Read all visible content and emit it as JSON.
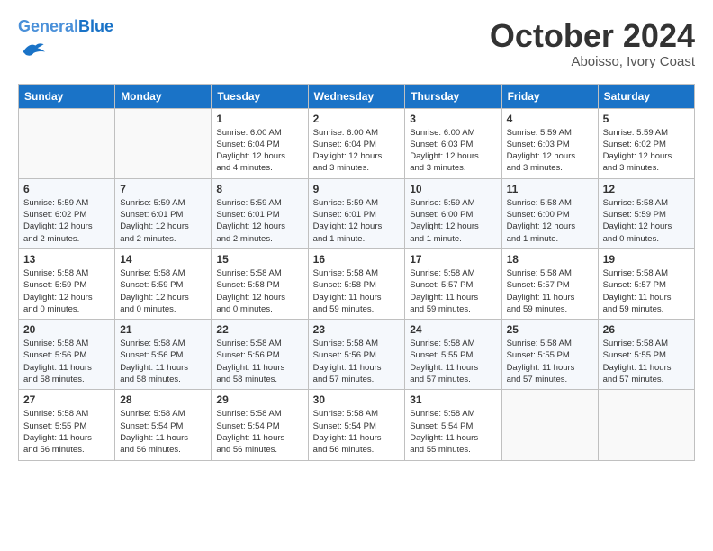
{
  "logo": {
    "text_general": "General",
    "text_blue": "Blue"
  },
  "header": {
    "month": "October 2024",
    "location": "Aboisso, Ivory Coast"
  },
  "weekdays": [
    "Sunday",
    "Monday",
    "Tuesday",
    "Wednesday",
    "Thursday",
    "Friday",
    "Saturday"
  ],
  "weeks": [
    [
      {
        "day": "",
        "info": ""
      },
      {
        "day": "",
        "info": ""
      },
      {
        "day": "1",
        "info": "Sunrise: 6:00 AM\nSunset: 6:04 PM\nDaylight: 12 hours\nand 4 minutes."
      },
      {
        "day": "2",
        "info": "Sunrise: 6:00 AM\nSunset: 6:04 PM\nDaylight: 12 hours\nand 3 minutes."
      },
      {
        "day": "3",
        "info": "Sunrise: 6:00 AM\nSunset: 6:03 PM\nDaylight: 12 hours\nand 3 minutes."
      },
      {
        "day": "4",
        "info": "Sunrise: 5:59 AM\nSunset: 6:03 PM\nDaylight: 12 hours\nand 3 minutes."
      },
      {
        "day": "5",
        "info": "Sunrise: 5:59 AM\nSunset: 6:02 PM\nDaylight: 12 hours\nand 3 minutes."
      }
    ],
    [
      {
        "day": "6",
        "info": "Sunrise: 5:59 AM\nSunset: 6:02 PM\nDaylight: 12 hours\nand 2 minutes."
      },
      {
        "day": "7",
        "info": "Sunrise: 5:59 AM\nSunset: 6:01 PM\nDaylight: 12 hours\nand 2 minutes."
      },
      {
        "day": "8",
        "info": "Sunrise: 5:59 AM\nSunset: 6:01 PM\nDaylight: 12 hours\nand 2 minutes."
      },
      {
        "day": "9",
        "info": "Sunrise: 5:59 AM\nSunset: 6:01 PM\nDaylight: 12 hours\nand 1 minute."
      },
      {
        "day": "10",
        "info": "Sunrise: 5:59 AM\nSunset: 6:00 PM\nDaylight: 12 hours\nand 1 minute."
      },
      {
        "day": "11",
        "info": "Sunrise: 5:58 AM\nSunset: 6:00 PM\nDaylight: 12 hours\nand 1 minute."
      },
      {
        "day": "12",
        "info": "Sunrise: 5:58 AM\nSunset: 5:59 PM\nDaylight: 12 hours\nand 0 minutes."
      }
    ],
    [
      {
        "day": "13",
        "info": "Sunrise: 5:58 AM\nSunset: 5:59 PM\nDaylight: 12 hours\nand 0 minutes."
      },
      {
        "day": "14",
        "info": "Sunrise: 5:58 AM\nSunset: 5:59 PM\nDaylight: 12 hours\nand 0 minutes."
      },
      {
        "day": "15",
        "info": "Sunrise: 5:58 AM\nSunset: 5:58 PM\nDaylight: 12 hours\nand 0 minutes."
      },
      {
        "day": "16",
        "info": "Sunrise: 5:58 AM\nSunset: 5:58 PM\nDaylight: 11 hours\nand 59 minutes."
      },
      {
        "day": "17",
        "info": "Sunrise: 5:58 AM\nSunset: 5:57 PM\nDaylight: 11 hours\nand 59 minutes."
      },
      {
        "day": "18",
        "info": "Sunrise: 5:58 AM\nSunset: 5:57 PM\nDaylight: 11 hours\nand 59 minutes."
      },
      {
        "day": "19",
        "info": "Sunrise: 5:58 AM\nSunset: 5:57 PM\nDaylight: 11 hours\nand 59 minutes."
      }
    ],
    [
      {
        "day": "20",
        "info": "Sunrise: 5:58 AM\nSunset: 5:56 PM\nDaylight: 11 hours\nand 58 minutes."
      },
      {
        "day": "21",
        "info": "Sunrise: 5:58 AM\nSunset: 5:56 PM\nDaylight: 11 hours\nand 58 minutes."
      },
      {
        "day": "22",
        "info": "Sunrise: 5:58 AM\nSunset: 5:56 PM\nDaylight: 11 hours\nand 58 minutes."
      },
      {
        "day": "23",
        "info": "Sunrise: 5:58 AM\nSunset: 5:56 PM\nDaylight: 11 hours\nand 57 minutes."
      },
      {
        "day": "24",
        "info": "Sunrise: 5:58 AM\nSunset: 5:55 PM\nDaylight: 11 hours\nand 57 minutes."
      },
      {
        "day": "25",
        "info": "Sunrise: 5:58 AM\nSunset: 5:55 PM\nDaylight: 11 hours\nand 57 minutes."
      },
      {
        "day": "26",
        "info": "Sunrise: 5:58 AM\nSunset: 5:55 PM\nDaylight: 11 hours\nand 57 minutes."
      }
    ],
    [
      {
        "day": "27",
        "info": "Sunrise: 5:58 AM\nSunset: 5:55 PM\nDaylight: 11 hours\nand 56 minutes."
      },
      {
        "day": "28",
        "info": "Sunrise: 5:58 AM\nSunset: 5:54 PM\nDaylight: 11 hours\nand 56 minutes."
      },
      {
        "day": "29",
        "info": "Sunrise: 5:58 AM\nSunset: 5:54 PM\nDaylight: 11 hours\nand 56 minutes."
      },
      {
        "day": "30",
        "info": "Sunrise: 5:58 AM\nSunset: 5:54 PM\nDaylight: 11 hours\nand 56 minutes."
      },
      {
        "day": "31",
        "info": "Sunrise: 5:58 AM\nSunset: 5:54 PM\nDaylight: 11 hours\nand 55 minutes."
      },
      {
        "day": "",
        "info": ""
      },
      {
        "day": "",
        "info": ""
      }
    ]
  ]
}
